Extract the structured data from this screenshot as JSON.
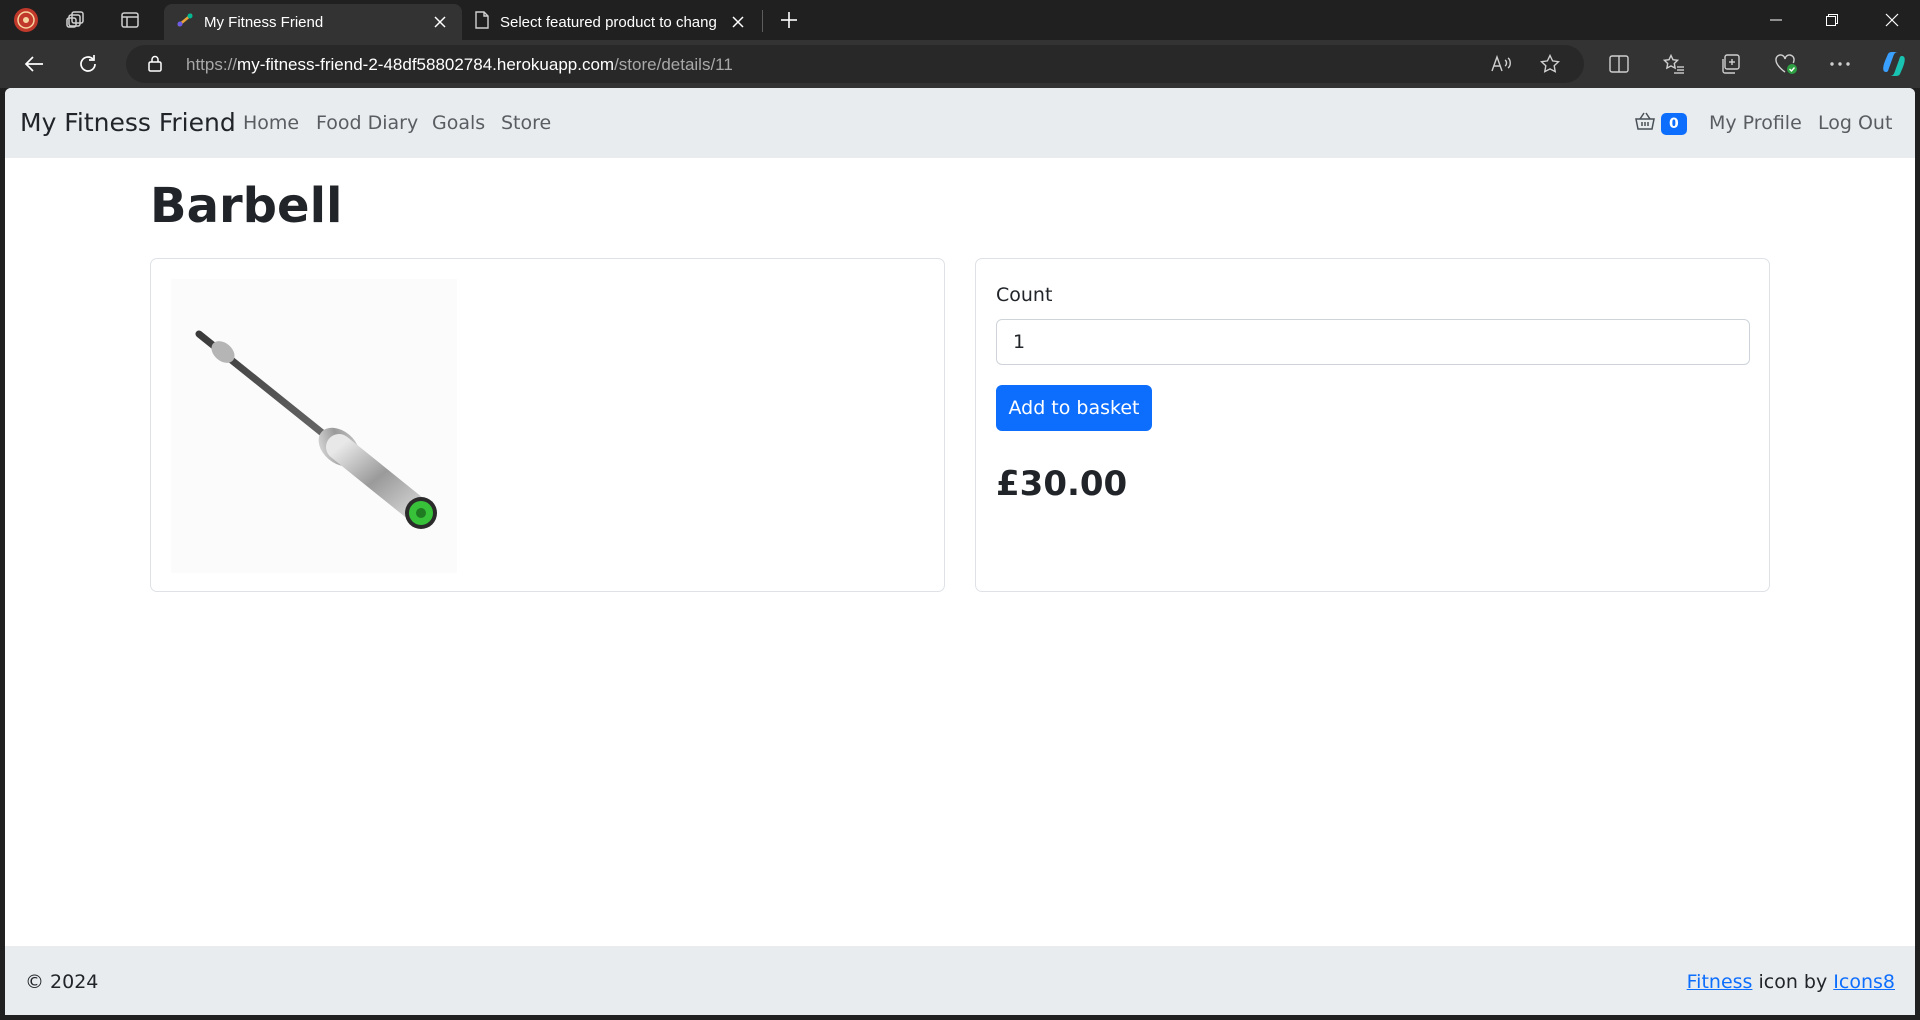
{
  "browser": {
    "tabs": [
      {
        "title": "My Fitness Friend",
        "active": true
      },
      {
        "title": "Select featured product to chang",
        "active": false
      }
    ],
    "url": {
      "scheme": "https://",
      "host": "my-fitness-friend-2-48df58802784.herokuapp.com",
      "path": "/store/details/11"
    },
    "colors": {
      "frame": "#202020",
      "toolbar": "#333333",
      "omnibox": "#282828"
    }
  },
  "site": {
    "brand": "My Fitness Friend",
    "nav": {
      "home": "Home",
      "food_diary": "Food Diary",
      "goals": "Goals",
      "store": "Store"
    },
    "basket_count": "0",
    "my_profile": "My Profile",
    "log_out": "Log Out"
  },
  "product": {
    "name": "Barbell",
    "count_label": "Count",
    "count_value": "1",
    "add_button": "Add to basket",
    "price": "£30.00",
    "image_icon": "barbell-image"
  },
  "footer": {
    "copyright": "© 2024",
    "credit_link1": "Fitness",
    "credit_text": " icon by ",
    "credit_link2": "Icons8"
  },
  "colors": {
    "primary": "#0d6efd",
    "navbar_bg": "#e9ecef",
    "text": "#212529"
  }
}
